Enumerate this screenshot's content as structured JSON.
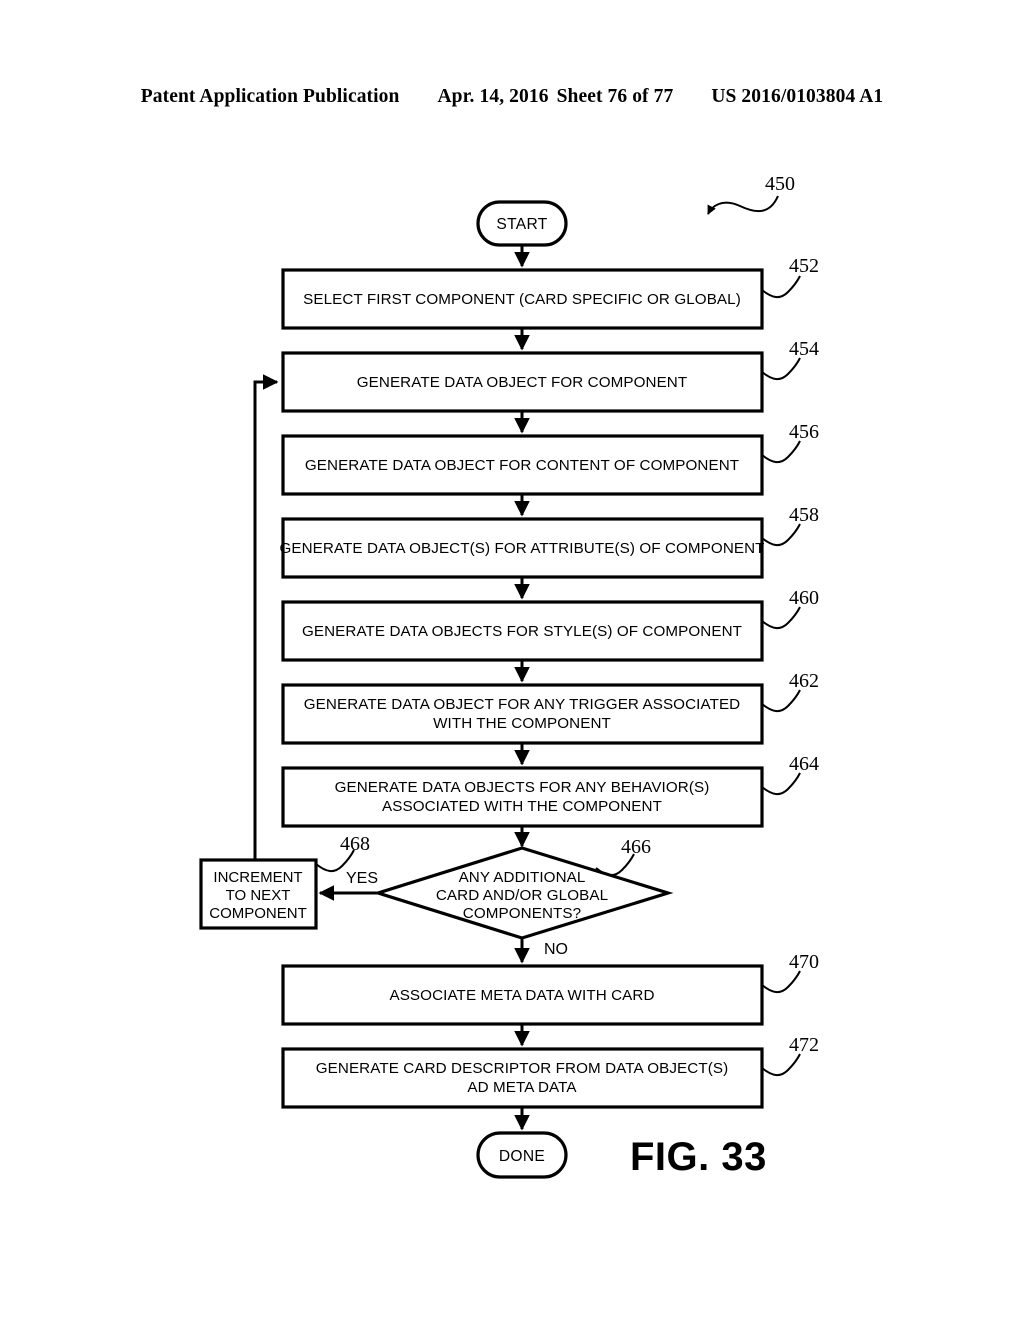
{
  "header": {
    "publication": "Patent Application Publication",
    "date": "Apr. 14, 2016",
    "sheet": "Sheet 76 of 77",
    "patent_number": "US 2016/0103804 A1"
  },
  "figure": {
    "label": "FIG. 33",
    "diagram_reference": "450",
    "start_label": "START",
    "done_label": "DONE",
    "yes_label": "YES",
    "no_label": "NO"
  },
  "steps": [
    {
      "ref": "452",
      "lines": [
        "SELECT FIRST COMPONENT (CARD SPECIFIC OR GLOBAL)"
      ]
    },
    {
      "ref": "454",
      "lines": [
        "GENERATE DATA OBJECT FOR COMPONENT"
      ]
    },
    {
      "ref": "456",
      "lines": [
        "GENERATE DATA OBJECT FOR CONTENT OF COMPONENT"
      ]
    },
    {
      "ref": "458",
      "lines": [
        "GENERATE DATA OBJECT(S) FOR ATTRIBUTE(S) OF COMPONENT"
      ]
    },
    {
      "ref": "460",
      "lines": [
        "GENERATE DATA OBJECTS FOR STYLE(S) OF COMPONENT"
      ]
    },
    {
      "ref": "462",
      "lines": [
        "GENERATE DATA OBJECT FOR ANY TRIGGER ASSOCIATED",
        "WITH THE COMPONENT"
      ]
    },
    {
      "ref": "464",
      "lines": [
        "GENERATE DATA OBJECTS FOR ANY BEHAVIOR(S)",
        "ASSOCIATED WITH THE COMPONENT"
      ]
    }
  ],
  "decision": {
    "ref": "466",
    "lines": [
      "ANY ADDITIONAL",
      "CARD AND/OR GLOBAL",
      "COMPONENTS?"
    ]
  },
  "increment": {
    "ref": "468",
    "lines": [
      "INCREMENT",
      "TO NEXT",
      "COMPONENT"
    ]
  },
  "tail_steps": [
    {
      "ref": "470",
      "lines": [
        "ASSOCIATE META DATA WITH CARD"
      ]
    },
    {
      "ref": "472",
      "lines": [
        "GENERATE CARD DESCRIPTOR FROM DATA OBJECT(S)",
        "AD META DATA"
      ]
    }
  ],
  "colors": {
    "ink": "#000000",
    "paper": "#ffffff"
  }
}
